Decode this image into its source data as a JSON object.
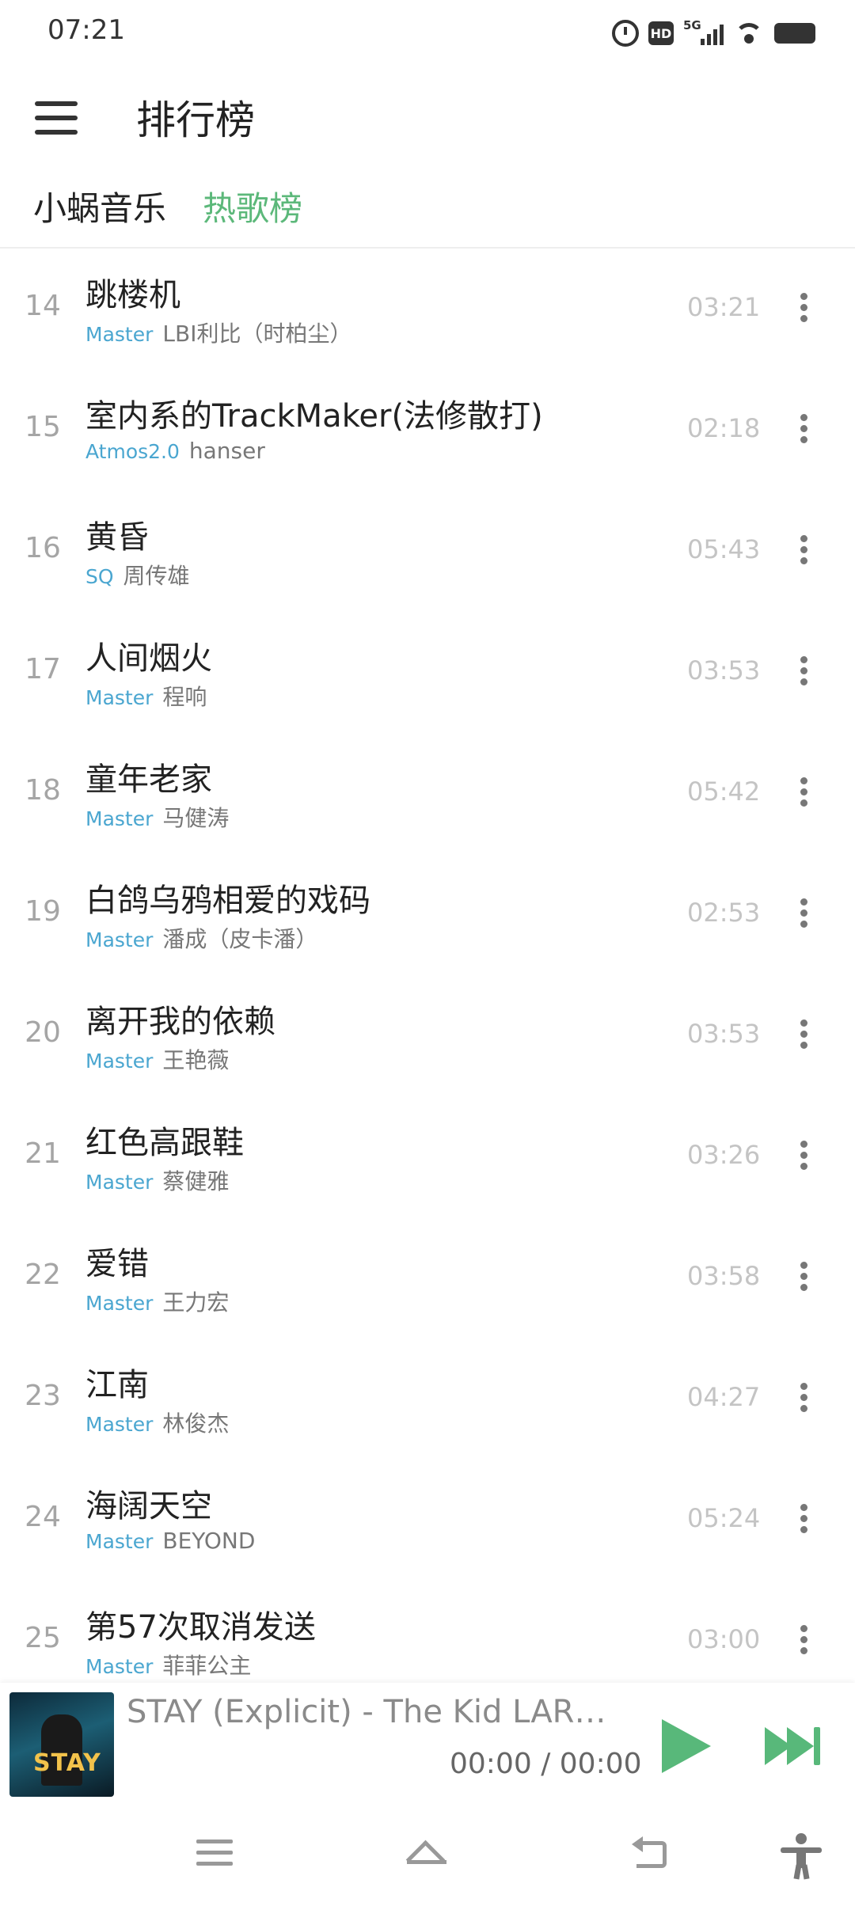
{
  "status_bar": {
    "time": "07:21",
    "icons": [
      "alarm-icon",
      "hd-icon",
      "5g-signal-icon",
      "wifi-icon",
      "battery-icon"
    ],
    "hd_label": "HD",
    "network_label": "5G"
  },
  "header": {
    "title": "排行榜",
    "menu_icon": "hamburger-menu-icon"
  },
  "tabs": [
    {
      "label": "小蜗音乐",
      "active": false
    },
    {
      "label": "热歌榜",
      "active": true
    }
  ],
  "colors": {
    "accent": "#5cb87a",
    "quality": "#4aa6d0",
    "rank": "#a5a5a5",
    "duration": "#c4c4c4"
  },
  "songs": [
    {
      "rank": "14",
      "title": "跳楼机",
      "quality": "Master",
      "artist": "LBI利比（时柏尘）",
      "duration": "03:21"
    },
    {
      "rank": "15",
      "title": "室内系的TrackMaker(法修散打)",
      "quality": "Atmos2.0",
      "artist": "hanser",
      "duration": "02:18"
    },
    {
      "rank": "16",
      "title": "黄昏",
      "quality": "SQ",
      "artist": "周传雄",
      "duration": "05:43"
    },
    {
      "rank": "17",
      "title": "人间烟火",
      "quality": "Master",
      "artist": "程响",
      "duration": "03:53"
    },
    {
      "rank": "18",
      "title": "童年老家",
      "quality": "Master",
      "artist": "马健涛",
      "duration": "05:42"
    },
    {
      "rank": "19",
      "title": "白鸽乌鸦相爱的戏码",
      "quality": "Master",
      "artist": "潘成（皮卡潘）",
      "duration": "02:53"
    },
    {
      "rank": "20",
      "title": "离开我的依赖",
      "quality": "Master",
      "artist": "王艳薇",
      "duration": "03:53"
    },
    {
      "rank": "21",
      "title": "红色高跟鞋",
      "quality": "Master",
      "artist": "蔡健雅",
      "duration": "03:26"
    },
    {
      "rank": "22",
      "title": "爱错",
      "quality": "Master",
      "artist": "王力宏",
      "duration": "03:58"
    },
    {
      "rank": "23",
      "title": "江南",
      "quality": "Master",
      "artist": "林俊杰",
      "duration": "04:27"
    },
    {
      "rank": "24",
      "title": "海阔天空",
      "quality": "Master",
      "artist": "BEYOND",
      "duration": "05:24"
    },
    {
      "rank": "25",
      "title": "第57次取消发送",
      "quality": "Master",
      "artist": "菲菲公主",
      "duration": "03:00"
    }
  ],
  "player": {
    "now_playing": "STAY (Explicit) - The Kid LAROI...",
    "time": "00:00 / 00:00",
    "cover_text": "STAY",
    "play_icon": "play-icon",
    "next_icon": "skip-next-icon"
  },
  "navbar": {
    "icons": [
      "recent-apps-icon",
      "home-icon",
      "back-icon",
      "accessibility-icon"
    ]
  }
}
